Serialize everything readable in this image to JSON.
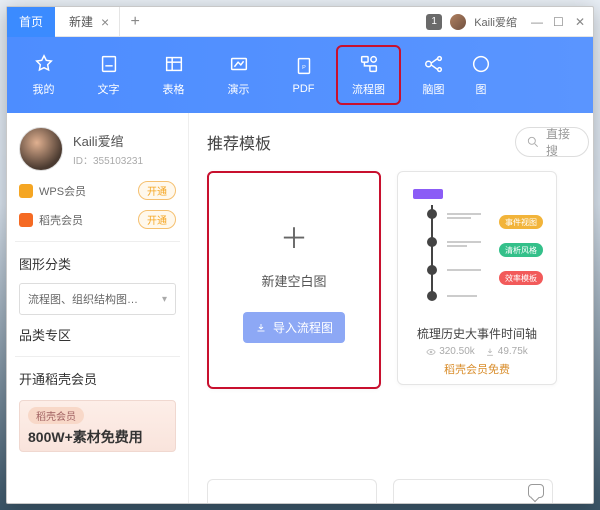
{
  "titlebar": {
    "home": "首页",
    "tab_label": "新建",
    "badge": "1",
    "username": "Kaili爱绾"
  },
  "toolbar": {
    "items": [
      {
        "label": "我的"
      },
      {
        "label": "文字"
      },
      {
        "label": "表格"
      },
      {
        "label": "演示"
      },
      {
        "label": "PDF"
      },
      {
        "label": "流程图",
        "highlight": true
      },
      {
        "label": "脑图"
      },
      {
        "label": "图"
      }
    ]
  },
  "sidebar": {
    "profile": {
      "name": "Kaili爱绾",
      "id": "ID：355103231"
    },
    "members": [
      {
        "label": "WPS会员",
        "action": "开通"
      },
      {
        "label": "稻壳会员",
        "action": "开通"
      }
    ],
    "cat_title": "图形分类",
    "cat_select": "流程图、组织结构图…",
    "zone_title": "品类专区",
    "vip_title": "开通稻壳会员",
    "promo_tag": "稻壳会员",
    "promo_big": "800W+素材免费用"
  },
  "main": {
    "title": "推荐模板",
    "search_placeholder": "直接搜",
    "blank_label": "新建空白图",
    "import_label": "导入流程图",
    "template": {
      "title": "梳理历史大事件时间轴",
      "views": "320.50k",
      "downloads": "49.75k",
      "foot": "稻壳会员免费",
      "pill1": "事件视图",
      "pill2": "清析风格",
      "pill3": "效率模板"
    }
  }
}
